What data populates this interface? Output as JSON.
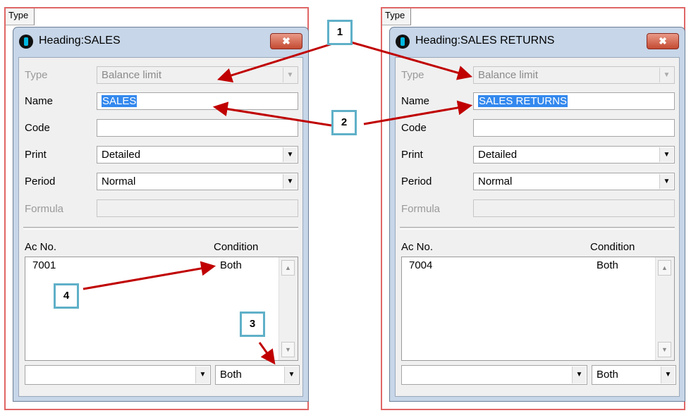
{
  "back_header": "Type",
  "dialogs": [
    {
      "title": "Heading:SALES",
      "close_label": "✖",
      "type_label": "Type",
      "type_value": "Balance limit",
      "name_label": "Name",
      "name_value": "SALES",
      "code_label": "Code",
      "code_value": "",
      "print_label": "Print",
      "print_value": "Detailed",
      "period_label": "Period",
      "period_value": "Normal",
      "formula_label": "Formula",
      "formula_value": "",
      "col_ac_no": "Ac No.",
      "col_condition": "Condition",
      "row_ac_no": "7001",
      "row_condition": "Both",
      "bottom_account_value": "",
      "bottom_condition_value": "Both"
    },
    {
      "title": "Heading:SALES RETURNS",
      "close_label": "✖",
      "type_label": "Type",
      "type_value": "Balance limit",
      "name_label": "Name",
      "name_value": "SALES RETURNS",
      "code_label": "Code",
      "code_value": "",
      "print_label": "Print",
      "print_value": "Detailed",
      "period_label": "Period",
      "period_value": "Normal",
      "formula_label": "Formula",
      "formula_value": "",
      "col_ac_no": "Ac No.",
      "col_condition": "Condition",
      "row_ac_no": "7004",
      "row_condition": "Both",
      "bottom_account_value": "",
      "bottom_condition_value": "Both"
    }
  ],
  "callouts": [
    "1",
    "2",
    "3",
    "4"
  ],
  "colors": {
    "annotation_arrow": "#c00000",
    "callout_border": "#5fb0c8",
    "panel_border": "#e06666"
  },
  "icons": {
    "app": "info-circle-icon",
    "close": "close-icon",
    "dropdown": "chevron-down-icon",
    "scroll_up": "scroll-up-icon",
    "scroll_down": "scroll-down-icon"
  }
}
